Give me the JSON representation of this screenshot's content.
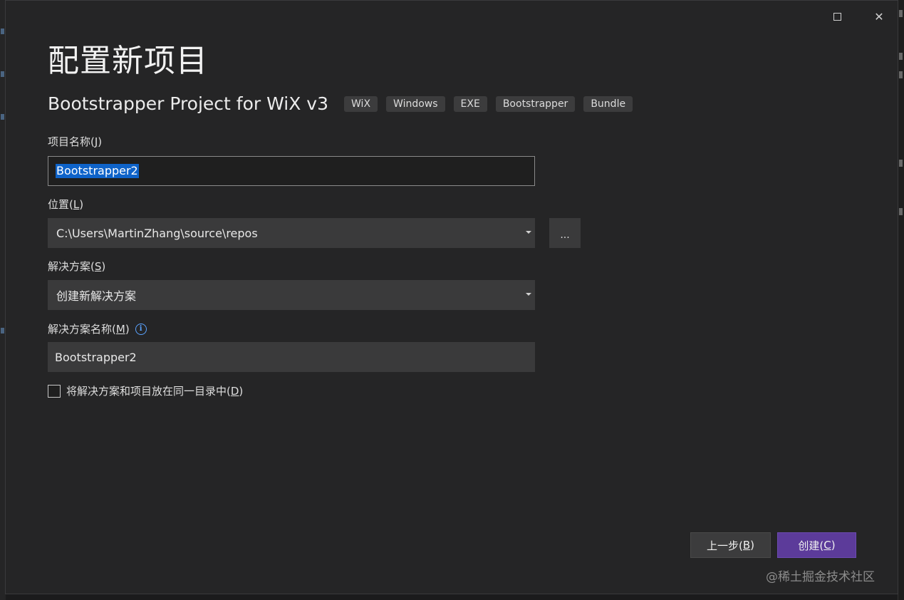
{
  "dialog": {
    "title": "配置新项目",
    "template": {
      "name": "Bootstrapper Project for WiX v3",
      "tags": [
        "WiX",
        "Windows",
        "EXE",
        "Bootstrapper",
        "Bundle"
      ]
    },
    "project_name": {
      "label_pre": "项目名称(",
      "label_key": "J",
      "label_post": ")",
      "value": "Bootstrapper2"
    },
    "location": {
      "label_pre": "位置(",
      "label_key": "L",
      "label_post": ")",
      "value": "C:\\Users\\MartinZhang\\source\\repos",
      "browse_label": "..."
    },
    "solution": {
      "label_pre": "解决方案(",
      "label_key": "S",
      "label_post": ")",
      "value": "创建新解决方案"
    },
    "solution_name": {
      "label_pre": "解决方案名称(",
      "label_key": "M",
      "label_post": ")",
      "value": "Bootstrapper2",
      "info_glyph": "i"
    },
    "same_dir": {
      "label_pre": "将解决方案和项目放在同一目录中(",
      "label_key": "D",
      "label_post": ")",
      "checked": false
    },
    "buttons": {
      "back_pre": "上一步(",
      "back_key": "B",
      "back_post": ")",
      "create_pre": "创建(",
      "create_key": "C",
      "create_post": ")"
    },
    "window_controls": {
      "close_glyph": "✕"
    }
  },
  "watermark": "@稀土掘金技术社区",
  "colors": {
    "dialog_bg": "#252526",
    "accent": "#5c3b9a",
    "selection": "#0e63c9",
    "info": "#5aa3ff"
  }
}
